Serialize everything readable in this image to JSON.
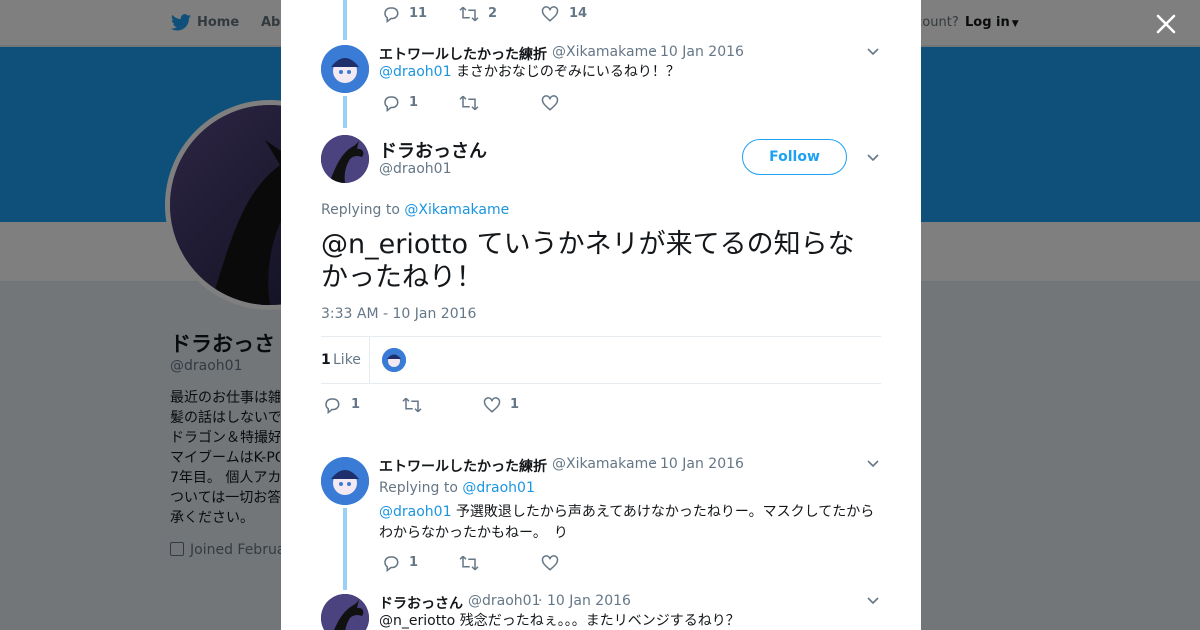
{
  "colors": {
    "brand": "#1da1f2",
    "link": "#1b95e0",
    "muted": "#657786",
    "thread_line": "#9ad0f5",
    "like": "#e0245e"
  },
  "nav": {
    "home": "Home",
    "about": "Abo",
    "have_account": "ccount?",
    "login": "Log in"
  },
  "profile": {
    "name": "ドラおっさ",
    "handle": "@draoh01",
    "bio_lines": [
      "最近のお仕事は雑",
      "髪の話はしないで",
      "ドラゴン＆特撮好",
      "マイブームはK-PO",
      "7年目。 個人アカ",
      "ついては一切お答",
      "承ください。"
    ],
    "joined": "Joined Februa"
  },
  "thread": {
    "top_actions": {
      "replies": "11",
      "retweets": "2",
      "likes": "14"
    },
    "reply1": {
      "name": "エトワールしたかった練折",
      "handle": "@Xikamakame",
      "dot": "·",
      "date": "10 Jan 2016",
      "mention": "@draoh01",
      "text": "まさかおなじのぞみにいるねり！？",
      "replies": "1"
    },
    "main": {
      "name": "ドラおっさん",
      "handle": "@draoh01",
      "follow": "Follow",
      "replying_prefix": "Replying to",
      "replying_to": "@Xikamakame",
      "text": "@n_eriotto ていうかネリが来てるの知らなかったねり！",
      "time": "3:33 AM - 10 Jan 2016",
      "like_count": "1",
      "like_label": "Like",
      "replies": "1",
      "likes": "1"
    },
    "reply2": {
      "name": "エトワールしたかった練折",
      "handle": "@Xikamakame",
      "dot": "·",
      "date": "10 Jan 2016",
      "replying_prefix": "Replying to",
      "replying_to": "@draoh01",
      "mention": "@draoh01",
      "text_line1": "予選敗退したから声あえてあけなかったねりー。マスクしてたから",
      "text_line2": "わからなかったかもねー。　り",
      "replies": "1"
    },
    "reply3": {
      "name": "ドラおっさん",
      "handle": "@draoh01",
      "dot": "·",
      "date": "10 Jan 2016",
      "text": "@n_eriotto 残念だったねぇ。。。またリベンジするねり？"
    }
  }
}
